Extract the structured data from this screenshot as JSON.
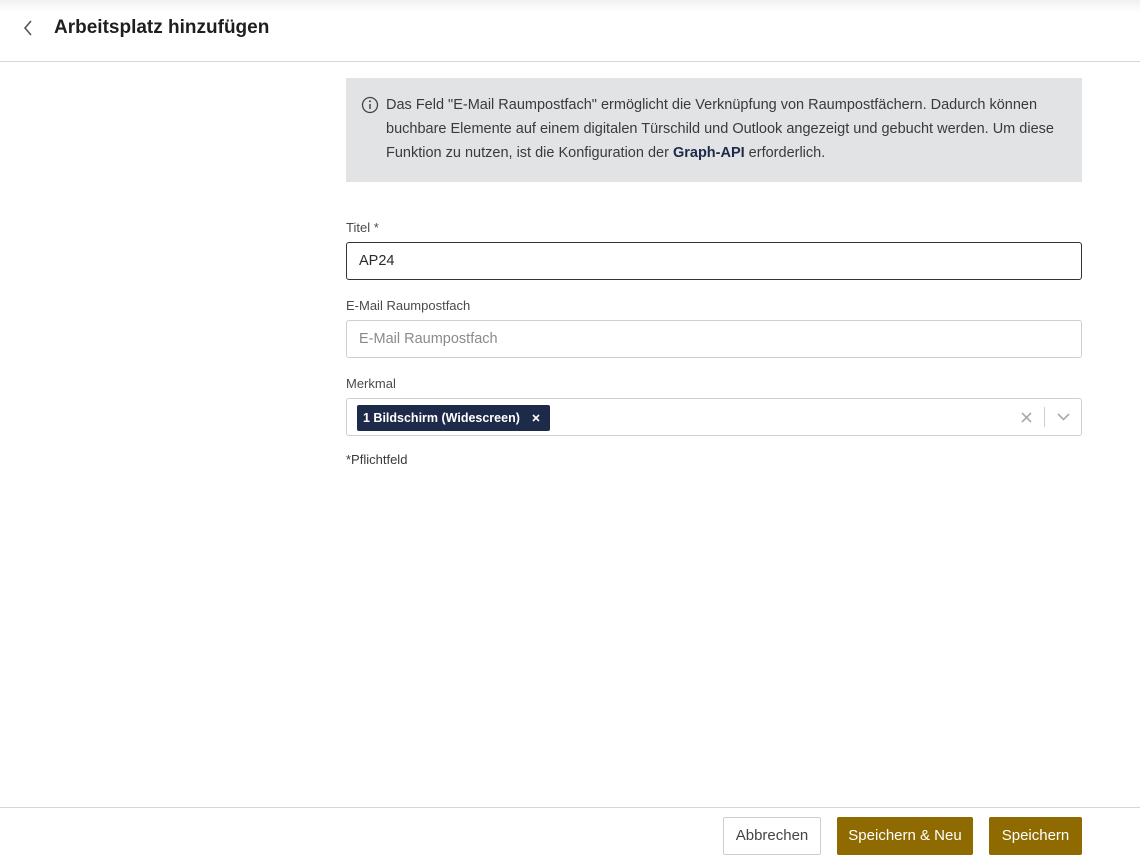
{
  "header": {
    "title": "Arbeitsplatz hinzufügen",
    "back_icon": "chevron-left-icon"
  },
  "info": {
    "icon": "info-circle-icon",
    "text_before": "Das Feld \"E-Mail Raumpostfach\" ermöglicht die Verknüpfung von Raumpostfächern. Dadurch können buchbare Elemente auf einem digitalen Türschild und Outlook angezeigt und gebucht werden. Um diese Funktion zu nutzen, ist die Konfiguration der ",
    "text_bold": "Graph-API",
    "text_after": " erforderlich."
  },
  "form": {
    "title_label": "Titel *",
    "title_value": "AP24",
    "email_label": "E-Mail Raumpostfach",
    "email_value": "",
    "email_placeholder": "E-Mail Raumpostfach",
    "feature_label": "Merkmal",
    "feature_selected": [
      "1 Bildschirm (Widescreen)"
    ],
    "required_note": "*Pflichtfeld"
  },
  "footer": {
    "cancel_label": "Abbrechen",
    "save_new_label": "Speichern & Neu",
    "save_label": "Speichern"
  },
  "colors": {
    "primary": "#8f6a00",
    "chip": "#1e2a4a",
    "info_bg": "#e2e3e4"
  }
}
